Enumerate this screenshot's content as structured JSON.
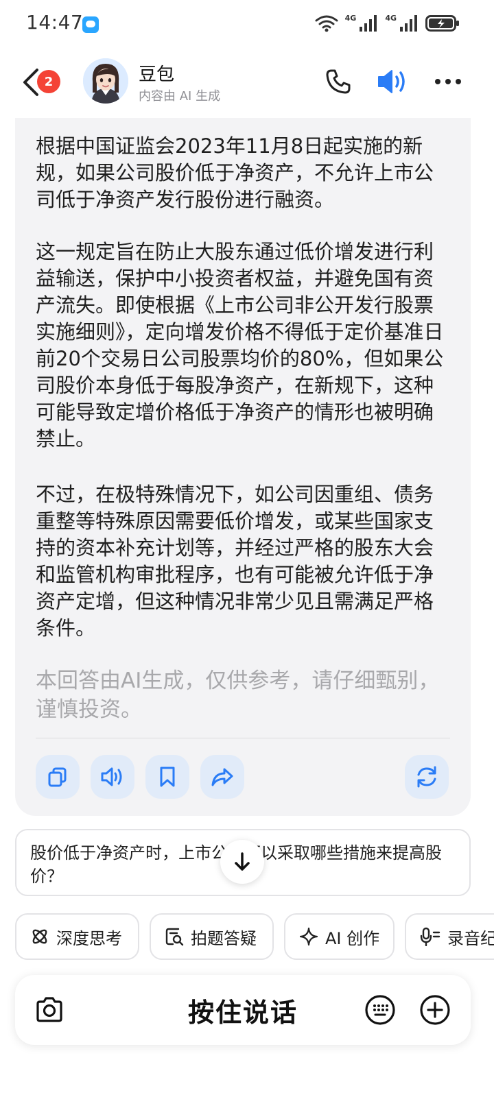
{
  "status_bar": {
    "time": "14:47",
    "network_1": "4G",
    "network_2": "4G"
  },
  "header": {
    "back_badge": "2",
    "name": "豆包",
    "subtitle": "内容由 AI 生成"
  },
  "answer": {
    "paragraphs": [
      "根据中国证监会2023年11月8日起实施的新规，如果公司股价低于净资产，不允许上市公司低于净资产发行股份进行融资。",
      "这一规定旨在防止大股东通过低价增发进行利益输送，保护中小投资者权益，并避免国有资产流失。即使根据《上市公司非公开发行股票实施细则》，定向增发价格不得低于定价基准日前20个交易日公司股票均价的80%，但如果公司股价本身低于每股净资产，在新规下，这种可能导致定增价格低于净资产的情形也被明确禁止。",
      "不过，在极特殊情况下，如公司因重组、债务重整等特殊原因需要低价增发，或某些国家支持的资本补充计划等，并经过严格的股东大会和监管机构审批程序，也有可能被允许低于净资产定增，但这种情况非常少见且需满足严格条件。"
    ],
    "disclaimer": "本回答由AI生成，仅供参考，请仔细甄别，谨慎投资。",
    "actions": [
      "copy-icon",
      "read-aloud-icon",
      "bookmark-icon",
      "share-icon",
      "regenerate-icon"
    ]
  },
  "suggestion": {
    "text": "股价低于净资产时，上市公司可以采取哪些措施来提高股价？"
  },
  "chips": [
    {
      "label": "深度思考",
      "icon": "atom-icon"
    },
    {
      "label": "拍题答疑",
      "icon": "photo-search-icon"
    },
    {
      "label": "AI 创作",
      "icon": "sparkle-icon"
    },
    {
      "label": "录音纪要",
      "icon": "mic-notes-icon"
    }
  ],
  "input_bar": {
    "hold_to_talk": "按住说话"
  },
  "colors": {
    "accent": "#2a7cf6",
    "card_bg": "#f3f3f5",
    "action_bg": "#e1ebf9",
    "badge": "#f44336"
  }
}
